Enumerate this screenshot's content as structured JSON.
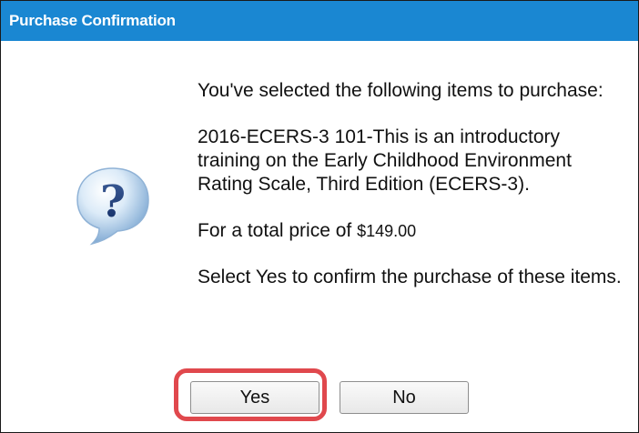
{
  "dialog": {
    "title": "Purchase Confirmation",
    "icon": "question-bubble-icon",
    "accent_color": "#1a87d2",
    "highlight_color": "#e0484d"
  },
  "message": {
    "intro": "You've selected the following items to purchase:",
    "item": "2016-ECERS-3 101-This is an introductory training on the Early Childhood Environment Rating Scale, Third Edition (ECERS-3).",
    "total_prefix": "For a total price of ",
    "total_price": "$149.00",
    "instruction": "Select Yes to confirm the purchase of these items."
  },
  "buttons": {
    "yes_label": "Yes",
    "no_label": "No"
  }
}
